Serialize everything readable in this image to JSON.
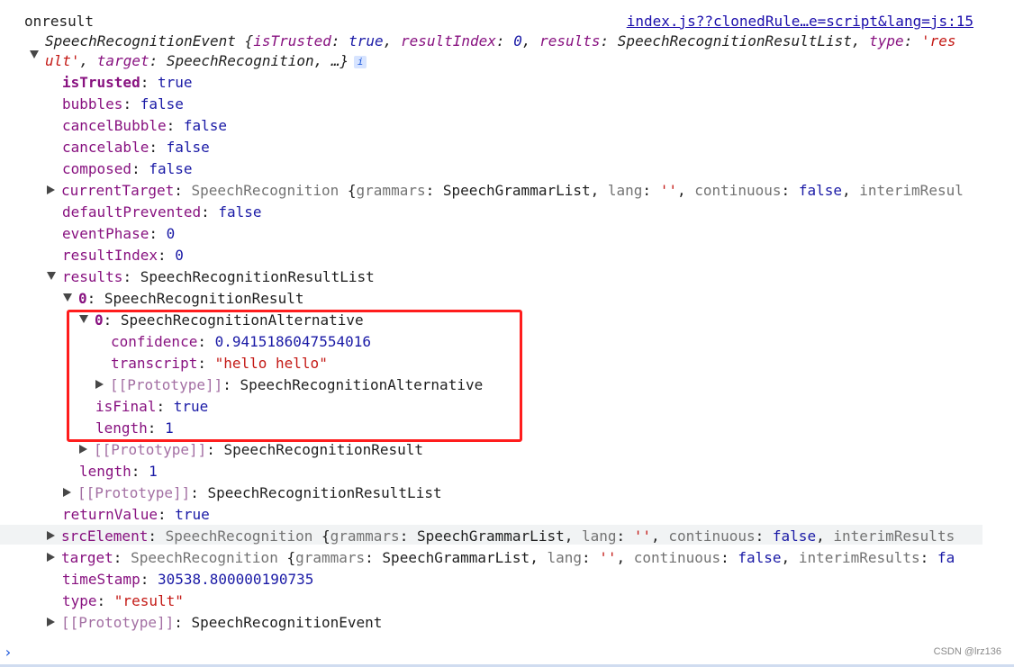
{
  "header": {
    "label": "onresult",
    "source_link": "index.js??clonedRule…e=script&lang=js:15"
  },
  "event_summary": {
    "type_name": "SpeechRecognitionEvent",
    "open_brace": " {",
    "p1_key": "isTrusted",
    "p1_val": "true",
    "p2_key": "resultIndex",
    "p2_val": "0",
    "p3_key": "results",
    "p3_val": "SpeechRecognitionResultList",
    "p4_key": "type",
    "p4_val_a": "'res",
    "p4_val_b": "ult'",
    "p5_key": "target",
    "p5_val": "SpeechRecognition",
    "ellipsis": "…}",
    "info_icon": "i"
  },
  "props": {
    "isTrusted": {
      "key": "isTrusted",
      "val": "true"
    },
    "bubbles": {
      "key": "bubbles",
      "val": "false"
    },
    "cancelBubble": {
      "key": "cancelBubble",
      "val": "false"
    },
    "cancelable": {
      "key": "cancelable",
      "val": "false"
    },
    "composed": {
      "key": "composed",
      "val": "false"
    },
    "currentTarget": {
      "key": "currentTarget",
      "type": "SpeechRecognition",
      "k1": "grammars",
      "v1": "SpeechGrammarList",
      "k2": "lang",
      "v2": "''",
      "k3": "continuous",
      "v3": "false",
      "k4": "interimResul"
    },
    "defaultPrevented": {
      "key": "defaultPrevented",
      "val": "false"
    },
    "eventPhase": {
      "key": "eventPhase",
      "val": "0"
    },
    "resultIndex": {
      "key": "resultIndex",
      "val": "0"
    },
    "results": {
      "key": "results",
      "val": "SpeechRecognitionResultList"
    },
    "result0": {
      "key": "0",
      "val": "SpeechRecognitionResult"
    },
    "alt0": {
      "key": "0",
      "val": "SpeechRecognitionAlternative"
    },
    "confidence": {
      "key": "confidence",
      "val": "0.9415186047554016"
    },
    "transcript": {
      "key": "transcript",
      "val": "\"hello hello\""
    },
    "alt_proto": {
      "key": "[[Prototype]]",
      "val": "SpeechRecognitionAlternative"
    },
    "isFinal": {
      "key": "isFinal",
      "val": "true"
    },
    "result_length": {
      "key": "length",
      "val": "1"
    },
    "result_proto": {
      "key": "[[Prototype]]",
      "val": "SpeechRecognitionResult"
    },
    "list_length": {
      "key": "length",
      "val": "1"
    },
    "list_proto": {
      "key": "[[Prototype]]",
      "val": "SpeechRecognitionResultList"
    },
    "returnValue": {
      "key": "returnValue",
      "val": "true"
    },
    "srcElement": {
      "key": "srcElement",
      "type": "SpeechRecognition",
      "k1": "grammars",
      "v1": "SpeechGrammarList",
      "k2": "lang",
      "v2": "''",
      "k3": "continuous",
      "v3": "false",
      "k4": "interimResults"
    },
    "target": {
      "key": "target",
      "type": "SpeechRecognition",
      "k1": "grammars",
      "v1": "SpeechGrammarList",
      "k2": "lang",
      "v2": "''",
      "k3": "continuous",
      "v3": "false",
      "k4": "interimResults",
      "v4": "fa"
    },
    "timeStamp": {
      "key": "timeStamp",
      "val": "30538.800000190735"
    },
    "type": {
      "key": "type",
      "val": "\"result\""
    },
    "event_proto": {
      "key": "[[Prototype]]",
      "val": "SpeechRecognitionEvent"
    }
  },
  "console": {
    "prompt_glyph": "›"
  },
  "watermark": "CSDN @lrz136",
  "colors": {
    "highlight": "#ff1d1d",
    "key": "#881280",
    "string": "#c41a16",
    "number": "#1a1aa6",
    "link": "#1a0dab"
  }
}
